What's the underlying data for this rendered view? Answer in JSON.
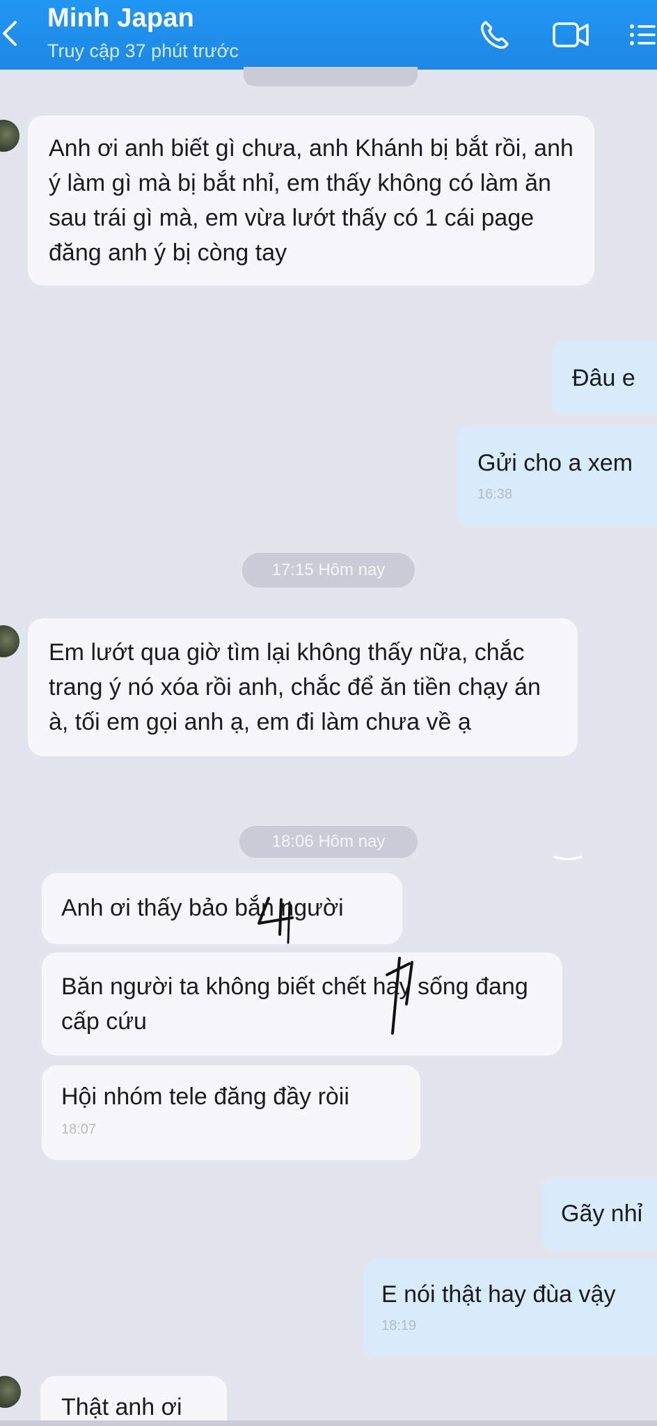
{
  "header": {
    "title": "Minh Japan",
    "subtitle": "Truy cập 37 phút trước",
    "icons": [
      "back-icon",
      "phone-icon",
      "video-call-icon",
      "menu-icon"
    ],
    "color": "#2196f3"
  },
  "messages": [
    {
      "dir": "in",
      "text": "Anh ơi anh biết gì chưa, anh Khánh bị bắt rồi, anh ý làm gì mà bị bắt nhỉ, em thấy không có làm ăn sau trái gì mà, em vừa lướt thấy có 1 cái page đăng anh ý bị còng tay"
    },
    {
      "dir": "out",
      "text": "Đâu e"
    },
    {
      "dir": "out",
      "text": "Gửi cho a xem",
      "time": "16:38"
    },
    {
      "type": "time-pill",
      "text": "17:15 Hôm nay"
    },
    {
      "dir": "in",
      "text": "Em lướt qua giờ tìm lại không thấy nữa, chắc trang ý nó xóa rồi anh, chắc để ăn tiền chạy án à, tối em gọi anh ạ, em đi làm chưa về ạ"
    },
    {
      "type": "time-pill",
      "text": "18:06 Hôm nay"
    },
    {
      "dir": "in",
      "text": "Anh ơi thấy bảo bắn người"
    },
    {
      "dir": "in",
      "text": "Băn người ta không biết chết hay sống đang cấp cứu"
    },
    {
      "dir": "in",
      "text": "Hội nhóm tele đăng đầy ròii",
      "time": "18:07"
    },
    {
      "dir": "out",
      "text": "Gãy nhỉ"
    },
    {
      "dir": "out",
      "text": "E nói thật hay đùa vậy",
      "time": "18:19"
    },
    {
      "dir": "in",
      "text": "Thật anh ơi"
    }
  ],
  "colors": {
    "background": "#e3e5ee",
    "incoming_bubble": "#f7f7fa",
    "outgoing_bubble": "#d8ebfb",
    "time_pill": "#c9ccd6"
  }
}
